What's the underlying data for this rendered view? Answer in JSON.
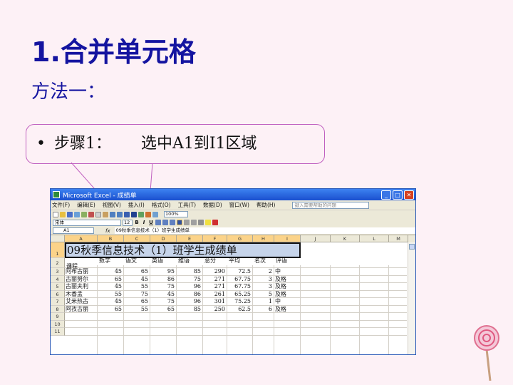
{
  "slide": {
    "title": "1.合并单元格",
    "method": "方法一：",
    "step_bullet": "•",
    "step_label": "步骤1：",
    "step_text": "选中A1到I1区域"
  },
  "excel": {
    "window_title": "Microsoft Excel - 成绩单",
    "window_buttons": [
      "_",
      "□",
      "✕"
    ],
    "menu": [
      "文件(F)",
      "编辑(E)",
      "视图(V)",
      "插入(I)",
      "格式(O)",
      "工具(T)",
      "数据(D)",
      "窗口(W)",
      "帮助(H)"
    ],
    "help_placeholder": "键入需要帮助的问题",
    "zoom": "100%",
    "font_name": "宋体",
    "font_size": "12",
    "format_buttons": [
      "B",
      "I",
      "U"
    ],
    "namebox": "A1",
    "fx_label": "fx",
    "formula": "09秋季信息技术（1）班学生成绩单",
    "columns": [
      "A",
      "B",
      "C",
      "D",
      "E",
      "F",
      "G",
      "H",
      "I",
      "J",
      "K",
      "L",
      "M"
    ],
    "row_numbers": [
      "1",
      "2",
      "3",
      "4",
      "5",
      "6",
      "7",
      "8",
      "9",
      "10",
      "11"
    ],
    "merged_title": "09秋季信息技术（1）班学生成绩单",
    "header_row": [
      "课程",
      "数学",
      "语文",
      "英语",
      "维语",
      "总分",
      "平均",
      "名次",
      "评语"
    ],
    "rows": [
      [
        "阿布古丽",
        "45",
        "65",
        "95",
        "85",
        "290",
        "72.5",
        "2",
        "中"
      ],
      [
        "古丽努尔",
        "65",
        "45",
        "86",
        "75",
        "271",
        "67.75",
        "3",
        "及格"
      ],
      [
        "古丽夫利",
        "45",
        "55",
        "75",
        "96",
        "271",
        "67.75",
        "3",
        "及格"
      ],
      [
        "木香孟",
        "55",
        "75",
        "45",
        "86",
        "261",
        "65.25",
        "5",
        "及格"
      ],
      [
        "艾米热古",
        "45",
        "65",
        "75",
        "96",
        "301",
        "75.25",
        "1",
        "中"
      ],
      [
        "阿孜古丽",
        "65",
        "55",
        "65",
        "85",
        "250",
        "62.5",
        "6",
        "及格"
      ]
    ]
  },
  "colors": {
    "background": "#fdf1f6",
    "title": "#1414a0",
    "callout_border": "#c060c0",
    "merged_fill": "#c6d4ea",
    "titlebar": "#1a4fcf"
  }
}
